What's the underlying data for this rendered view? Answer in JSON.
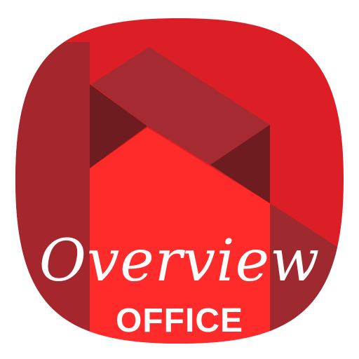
{
  "app_icon": {
    "script_text": "Overview",
    "sub_text": "OFFICE",
    "colors": {
      "background": "#ffffff",
      "base_red": "#dc1f26",
      "left_band": "#a6262e",
      "bright_band": "#ff2a2a",
      "mid_bar": "#a52a31",
      "dark_shade": "#6e1c20",
      "right_shade": "#9e2a30",
      "text": "#ffffff"
    }
  }
}
